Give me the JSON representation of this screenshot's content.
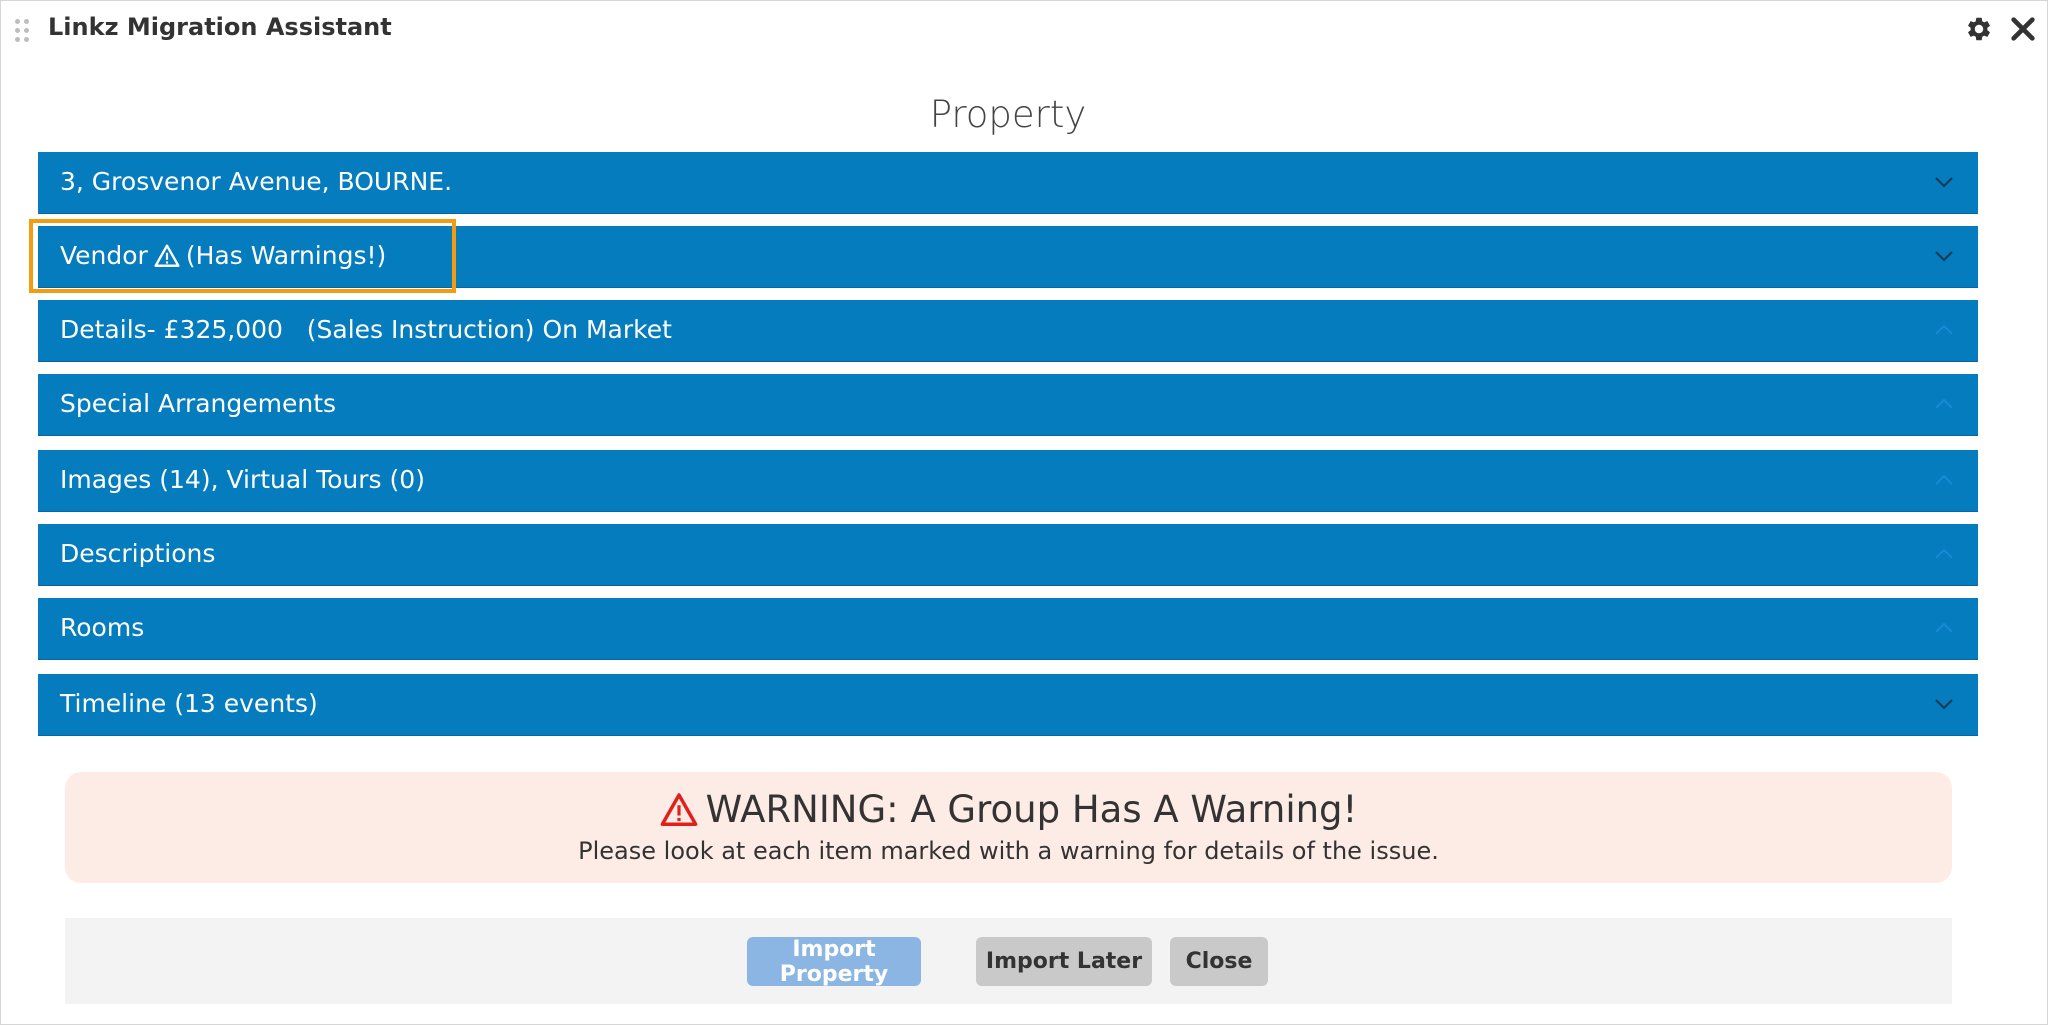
{
  "window": {
    "title": "Linkz Migration Assistant"
  },
  "section": {
    "title": "Property"
  },
  "groups": [
    {
      "label": "3, Grosvenor Avenue, BOURNE.",
      "chevron": "chevron-down-icon"
    },
    {
      "label_before": "Vendor",
      "label_after": "(Has Warnings!)",
      "chevron": "chevron-down-icon",
      "warning": true
    },
    {
      "label": "Details- £325,000   (Sales Instruction) On Market",
      "chevron": "chevron-up-icon"
    },
    {
      "label": "Special Arrangements",
      "chevron": "chevron-up-icon"
    },
    {
      "label": "Images (14), Virtual Tours (0)",
      "chevron": "chevron-up-icon"
    },
    {
      "label": "Descriptions",
      "chevron": "chevron-up-icon"
    },
    {
      "label": "Rooms",
      "chevron": "chevron-up-icon"
    },
    {
      "label": "Timeline (13 events)",
      "chevron": "chevron-down-icon"
    }
  ],
  "alert": {
    "heading": "WARNING: A Group Has A Warning!",
    "message": "Please look at each item marked with a warning for details of the issue."
  },
  "buttons": {
    "import": "Import Property",
    "later": "Import Later",
    "close": "Close"
  },
  "colors": {
    "bar": "#047cbe",
    "highlight": "#f39c12",
    "alert_bg": "#fdece6",
    "warning_red": "#e0201b"
  }
}
